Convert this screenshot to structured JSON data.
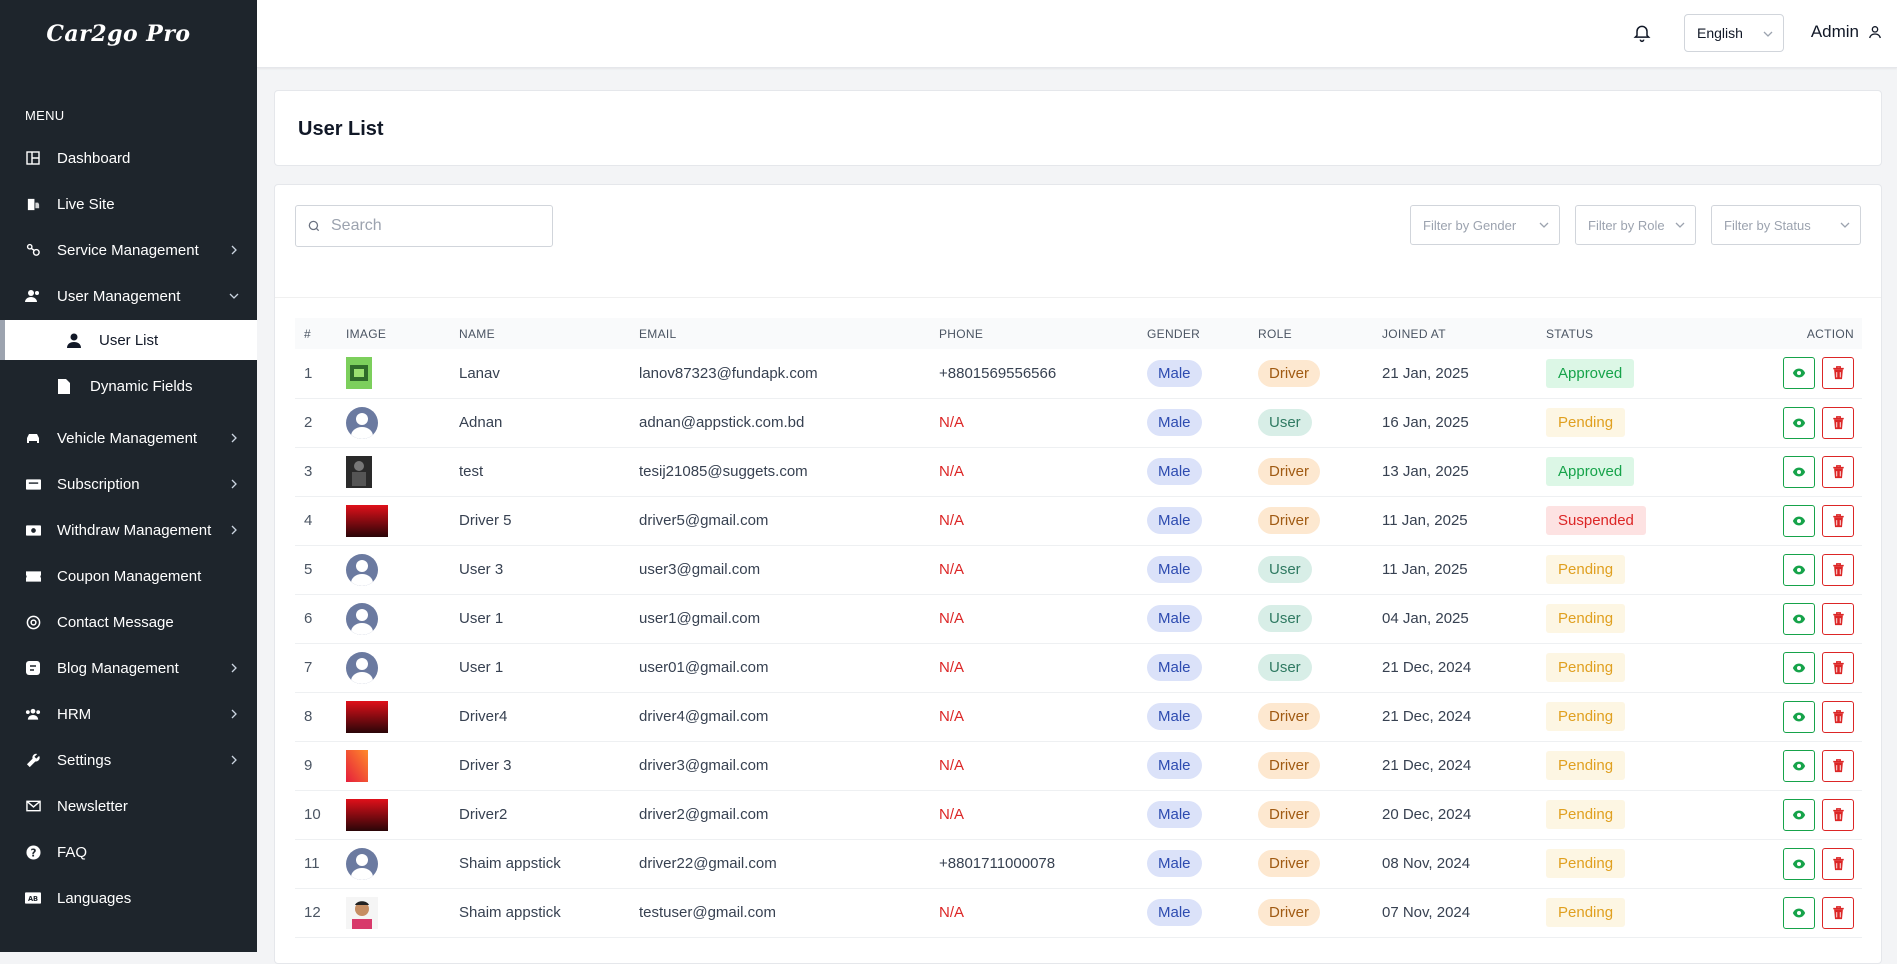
{
  "app": {
    "logo": "Car2go Pro"
  },
  "sidebar": {
    "menu_title": "MENU",
    "items": [
      {
        "label": "Dashboard",
        "icon": "dashboard-icon",
        "chevron": false
      },
      {
        "label": "Live Site",
        "icon": "live-site-icon",
        "chevron": false
      },
      {
        "label": "Service Management",
        "icon": "service-icon",
        "chevron": "right"
      },
      {
        "label": "User Management",
        "icon": "users-icon",
        "chevron": "down"
      },
      {
        "label": "Vehicle Management",
        "icon": "car-icon",
        "chevron": "right"
      },
      {
        "label": "Subscription",
        "icon": "subscription-icon",
        "chevron": "right"
      },
      {
        "label": "Withdraw Management",
        "icon": "withdraw-icon",
        "chevron": "right"
      },
      {
        "label": "Coupon Management",
        "icon": "coupon-icon",
        "chevron": false
      },
      {
        "label": "Contact Message",
        "icon": "contact-icon",
        "chevron": false
      },
      {
        "label": "Blog Management",
        "icon": "blog-icon",
        "chevron": "right"
      },
      {
        "label": "HRM",
        "icon": "hrm-icon",
        "chevron": "right"
      },
      {
        "label": "Settings",
        "icon": "wrench-icon",
        "chevron": "right"
      },
      {
        "label": "Newsletter",
        "icon": "mail-icon",
        "chevron": false
      },
      {
        "label": "FAQ",
        "icon": "question-icon",
        "chevron": false
      },
      {
        "label": "Languages",
        "icon": "language-icon",
        "chevron": false
      }
    ],
    "sub_items": [
      {
        "label": "User List",
        "icon": "user-icon",
        "active": true
      },
      {
        "label": "Dynamic Fields",
        "icon": "file-icon",
        "active": false
      }
    ]
  },
  "topbar": {
    "language": "English",
    "user": "Admin"
  },
  "page": {
    "title": "User List"
  },
  "search": {
    "placeholder": "Search"
  },
  "filters": {
    "gender": "Filter by Gender",
    "role": "Filter by Role",
    "status": "Filter by Status"
  },
  "table": {
    "headers": [
      "#",
      "IMAGE",
      "NAME",
      "EMAIL",
      "PHONE",
      "GENDER",
      "ROLE",
      "JOINED AT",
      "STATUS",
      "ACTION"
    ],
    "rows": [
      {
        "n": "1",
        "img": "green",
        "name": "Lanav",
        "email": "lanov87323@fundapk.com",
        "phone": "+8801569556566",
        "gender": "Male",
        "role": "Driver",
        "joined": "21 Jan, 2025",
        "status": "Approved"
      },
      {
        "n": "2",
        "img": "avatar",
        "name": "Adnan",
        "email": "adnan@appstick.com.bd",
        "phone": "N/A",
        "gender": "Male",
        "role": "User",
        "joined": "16 Jan, 2025",
        "status": "Pending"
      },
      {
        "n": "3",
        "img": "dark",
        "name": "test",
        "email": "tesij21085@suggets.com",
        "phone": "N/A",
        "gender": "Male",
        "role": "Driver",
        "joined": "13 Jan, 2025",
        "status": "Approved"
      },
      {
        "n": "4",
        "img": "red",
        "name": "Driver 5",
        "email": "driver5@gmail.com",
        "phone": "N/A",
        "gender": "Male",
        "role": "Driver",
        "joined": "11 Jan, 2025",
        "status": "Suspended"
      },
      {
        "n": "5",
        "img": "avatar",
        "name": "User 3",
        "email": "user3@gmail.com",
        "phone": "N/A",
        "gender": "Male",
        "role": "User",
        "joined": "11 Jan, 2025",
        "status": "Pending"
      },
      {
        "n": "6",
        "img": "avatar",
        "name": "User 1",
        "email": "user1@gmail.com",
        "phone": "N/A",
        "gender": "Male",
        "role": "User",
        "joined": "04 Jan, 2025",
        "status": "Pending"
      },
      {
        "n": "7",
        "img": "avatar",
        "name": "User 1",
        "email": "user01@gmail.com",
        "phone": "N/A",
        "gender": "Male",
        "role": "User",
        "joined": "21 Dec, 2024",
        "status": "Pending"
      },
      {
        "n": "8",
        "img": "red",
        "name": "Driver4",
        "email": "driver4@gmail.com",
        "phone": "N/A",
        "gender": "Male",
        "role": "Driver",
        "joined": "21 Dec, 2024",
        "status": "Pending"
      },
      {
        "n": "9",
        "img": "orange",
        "name": "Driver 3",
        "email": "driver3@gmail.com",
        "phone": "N/A",
        "gender": "Male",
        "role": "Driver",
        "joined": "21 Dec, 2024",
        "status": "Pending"
      },
      {
        "n": "10",
        "img": "red",
        "name": "Driver2",
        "email": "driver2@gmail.com",
        "phone": "N/A",
        "gender": "Male",
        "role": "Driver",
        "joined": "20 Dec, 2024",
        "status": "Pending"
      },
      {
        "n": "11",
        "img": "avatar",
        "name": "Shaim appstick",
        "email": "driver22@gmail.com",
        "phone": "+8801711000078",
        "gender": "Male",
        "role": "Driver",
        "joined": "08 Nov, 2024",
        "status": "Pending"
      },
      {
        "n": "12",
        "img": "person",
        "name": "Shaim appstick",
        "email": "testuser@gmail.com",
        "phone": "N/A",
        "gender": "Male",
        "role": "Driver",
        "joined": "07 Nov, 2024",
        "status": "Pending"
      }
    ]
  },
  "colors": {
    "sidebar": "#1e252c",
    "approved": "#16a34a",
    "pending": "#e0a020",
    "suspended": "#dc2626",
    "na": "#dc2626"
  }
}
